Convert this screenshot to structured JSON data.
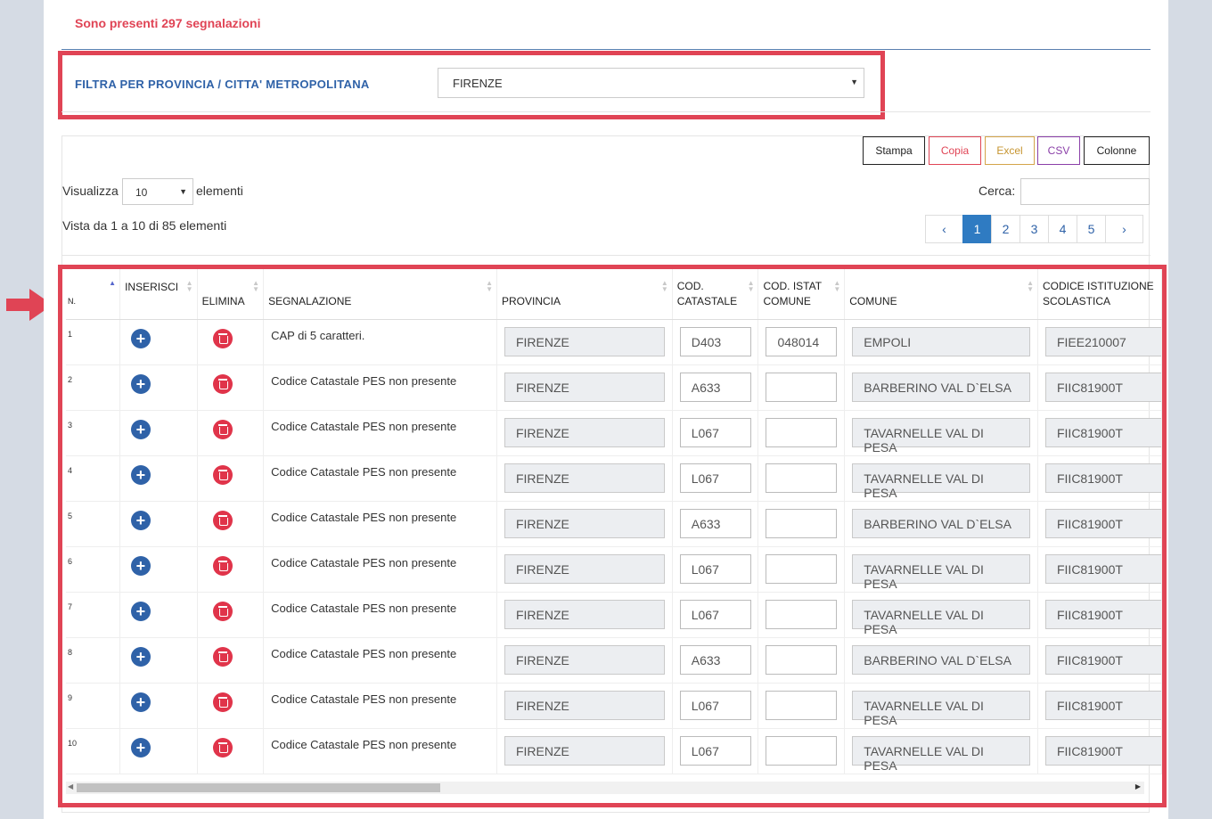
{
  "summary": "Sono presenti 297 segnalazioni",
  "filter": {
    "label": "FILTRA PER PROVINCIA / CITTA' METROPOLITANA",
    "selected": "FIRENZE"
  },
  "toolbar": {
    "stampa": "Stampa",
    "copia": "Copia",
    "excel": "Excel",
    "csv": "CSV",
    "colonne": "Colonne"
  },
  "length": {
    "prefix": "Visualizza",
    "value": "10",
    "suffix": "elementi"
  },
  "search": {
    "label": "Cerca:",
    "value": ""
  },
  "info": "Vista da 1 a 10 di 85 elementi",
  "pagination": {
    "prev": "‹",
    "pages": [
      "1",
      "2",
      "3",
      "4",
      "5"
    ],
    "active": "1",
    "next": "›"
  },
  "columns": {
    "n": "N.",
    "inserisci": "INSERISCI",
    "elimina": "ELIMINA",
    "segnalazione": "SEGNALAZIONE",
    "provincia": "PROVINCIA",
    "cod_catastale": "COD. CATASTALE",
    "cod_istat": "COD. ISTAT COMUNE",
    "comune": "COMUNE",
    "codice_istituzione": "CODICE ISTITUZIONE SCOLASTICA"
  },
  "rows": [
    {
      "n": "1",
      "segnalazione": "CAP di 5 caratteri.",
      "provincia": "FIRENZE",
      "cod_catastale": "D403",
      "cod_istat": "048014",
      "comune": "EMPOLI",
      "codice": "FIEE210007"
    },
    {
      "n": "2",
      "segnalazione": "Codice Catastale PES non presente",
      "provincia": "FIRENZE",
      "cod_catastale": "A633",
      "cod_istat": "",
      "comune": "BARBERINO VAL D`ELSA",
      "codice": "FIIC81900T"
    },
    {
      "n": "3",
      "segnalazione": "Codice Catastale PES non presente",
      "provincia": "FIRENZE",
      "cod_catastale": "L067",
      "cod_istat": "",
      "comune": "TAVARNELLE VAL DI PESA",
      "codice": "FIIC81900T"
    },
    {
      "n": "4",
      "segnalazione": "Codice Catastale PES non presente",
      "provincia": "FIRENZE",
      "cod_catastale": "L067",
      "cod_istat": "",
      "comune": "TAVARNELLE VAL DI PESA",
      "codice": "FIIC81900T"
    },
    {
      "n": "5",
      "segnalazione": "Codice Catastale PES non presente",
      "provincia": "FIRENZE",
      "cod_catastale": "A633",
      "cod_istat": "",
      "comune": "BARBERINO VAL D`ELSA",
      "codice": "FIIC81900T"
    },
    {
      "n": "6",
      "segnalazione": "Codice Catastale PES non presente",
      "provincia": "FIRENZE",
      "cod_catastale": "L067",
      "cod_istat": "",
      "comune": "TAVARNELLE VAL DI PESA",
      "codice": "FIIC81900T"
    },
    {
      "n": "7",
      "segnalazione": "Codice Catastale PES non presente",
      "provincia": "FIRENZE",
      "cod_catastale": "L067",
      "cod_istat": "",
      "comune": "TAVARNELLE VAL DI PESA",
      "codice": "FIIC81900T"
    },
    {
      "n": "8",
      "segnalazione": "Codice Catastale PES non presente",
      "provincia": "FIRENZE",
      "cod_catastale": "A633",
      "cod_istat": "",
      "comune": "BARBERINO VAL D`ELSA",
      "codice": "FIIC81900T"
    },
    {
      "n": "9",
      "segnalazione": "Codice Catastale PES non presente",
      "provincia": "FIRENZE",
      "cod_catastale": "L067",
      "cod_istat": "",
      "comune": "TAVARNELLE VAL DI PESA",
      "codice": "FIIC81900T"
    },
    {
      "n": "10",
      "segnalazione": "Codice Catastale PES non presente",
      "provincia": "FIRENZE",
      "cod_catastale": "L067",
      "cod_istat": "",
      "comune": "TAVARNELLE VAL DI PESA",
      "codice": "FIIC81900T"
    }
  ],
  "colors": {
    "accent_red": "#e04455",
    "primary_blue": "#2f62a8",
    "active_page": "#2f7bc2"
  },
  "icons": {
    "insert": "plus-circle-icon",
    "delete": "trash-circle-icon",
    "pointer": "arrow-right-icon"
  }
}
